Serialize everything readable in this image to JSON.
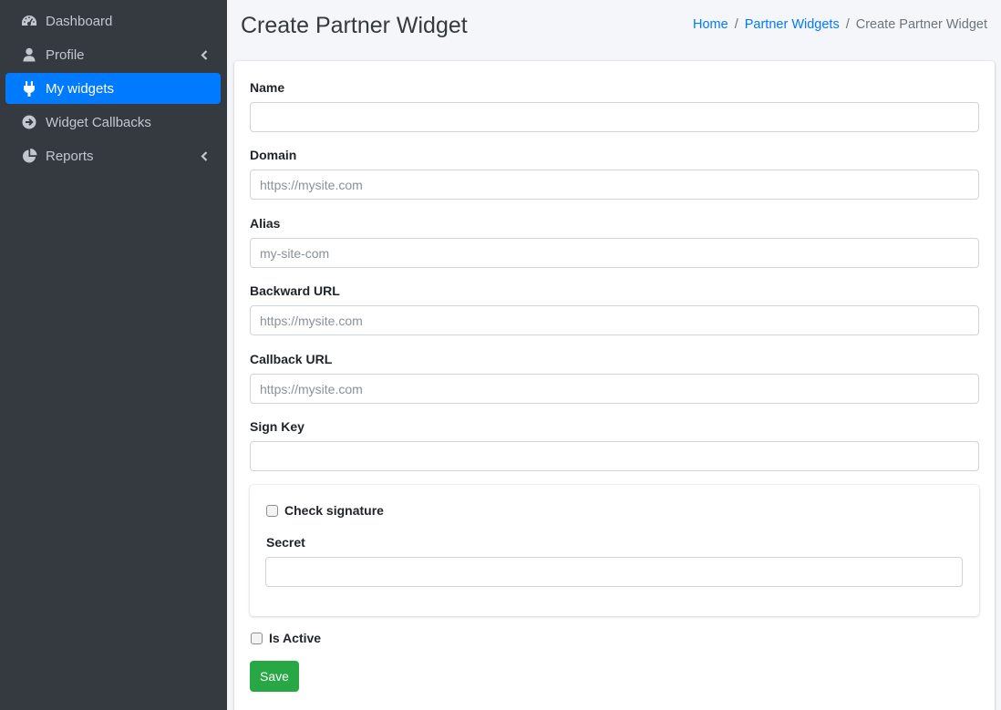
{
  "sidebar": {
    "items": [
      {
        "label": "Dashboard",
        "icon": "dashboard-gauge-icon",
        "active": false
      },
      {
        "label": "Profile",
        "icon": "user-icon",
        "active": false,
        "has_children": true
      },
      {
        "label": "My widgets",
        "icon": "plug-icon",
        "active": true
      },
      {
        "label": "Widget Callbacks",
        "icon": "arrow-circle-right-icon",
        "active": false
      },
      {
        "label": "Reports",
        "icon": "pie-chart-icon",
        "active": false,
        "has_children": true
      }
    ]
  },
  "header": {
    "title": "Create Partner Widget",
    "breadcrumb": [
      "Home",
      "Partner Widgets",
      "Create Partner Widget"
    ]
  },
  "form": {
    "name": {
      "label": "Name",
      "value": "",
      "placeholder": ""
    },
    "domain": {
      "label": "Domain",
      "value": "",
      "placeholder": "https://mysite.com"
    },
    "alias": {
      "label": "Alias",
      "value": "",
      "placeholder": "my-site-com"
    },
    "backward_url": {
      "label": "Backward URL",
      "value": "",
      "placeholder": "https://mysite.com"
    },
    "callback_url": {
      "label": "Callback URL",
      "value": "",
      "placeholder": "https://mysite.com"
    },
    "sign_key": {
      "label": "Sign Key",
      "value": "",
      "placeholder": ""
    },
    "check_signature": {
      "label": "Check signature",
      "checked": false
    },
    "secret": {
      "label": "Secret",
      "value": "",
      "placeholder": ""
    },
    "is_active": {
      "label": "Is Active",
      "checked": false
    },
    "save_label": "Save"
  },
  "colors": {
    "sidebar_bg": "#343a40",
    "active_nav": "#007bff",
    "link": "#007bff",
    "save_button": "#28a745",
    "content_bg": "#f4f6f9"
  }
}
